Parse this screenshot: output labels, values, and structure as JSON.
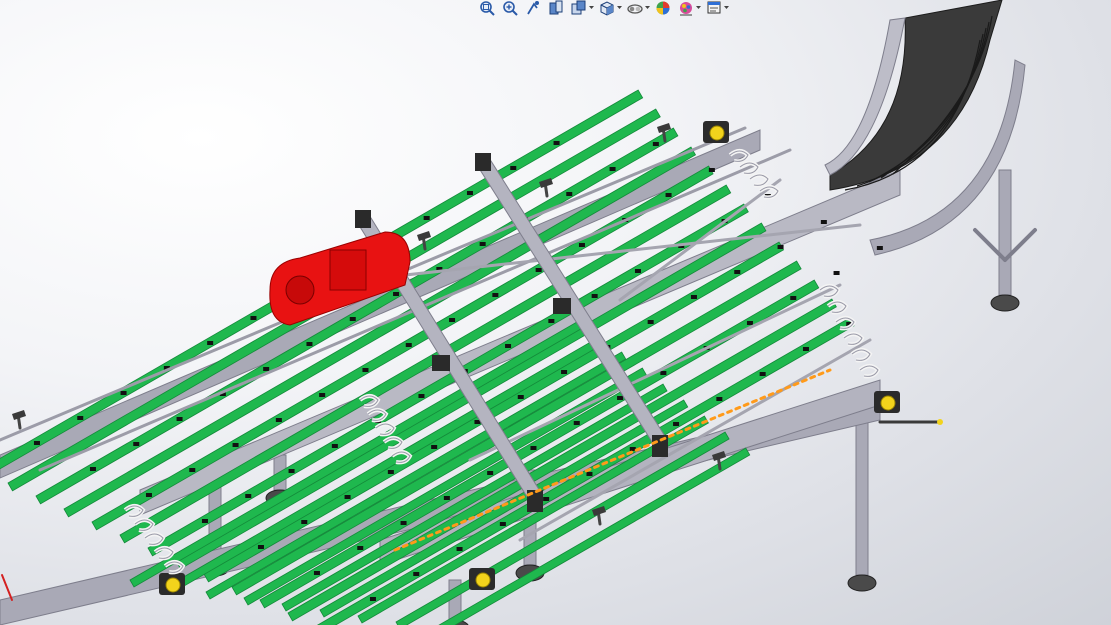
{
  "app": {
    "title": ""
  },
  "toolbar": {
    "items": [
      {
        "name": "zoom-to-fit-icon",
        "has_dropdown": false
      },
      {
        "name": "zoom-to-area-icon",
        "has_dropdown": false
      },
      {
        "name": "previous-view-icon",
        "has_dropdown": false
      },
      {
        "name": "section-view-icon",
        "has_dropdown": false
      },
      {
        "name": "dynamic-annotation-icon",
        "has_dropdown": true
      },
      {
        "name": "view-orientation-icon",
        "has_dropdown": true
      },
      {
        "name": "display-style-icon",
        "has_dropdown": true
      },
      {
        "name": "hide-show-items-icon",
        "has_dropdown": false
      },
      {
        "name": "edit-appearance-icon",
        "has_dropdown": true
      },
      {
        "name": "apply-scene-icon",
        "has_dropdown": true
      }
    ]
  },
  "colors": {
    "belt_green": "#1fb84e",
    "belt_green_dark": "#14893a",
    "frame_gray": "#a9a9b6",
    "frame_dark": "#7e7e8c",
    "motor_red": "#e81212",
    "curve_belt": "#3a3a3a",
    "sensor_yellow": "#f2d31c",
    "dashed_line": "#ff9a1a"
  },
  "model": {
    "name": "conveyor-assembly",
    "straight_belt_count": 13,
    "curve_segments": 6
  }
}
